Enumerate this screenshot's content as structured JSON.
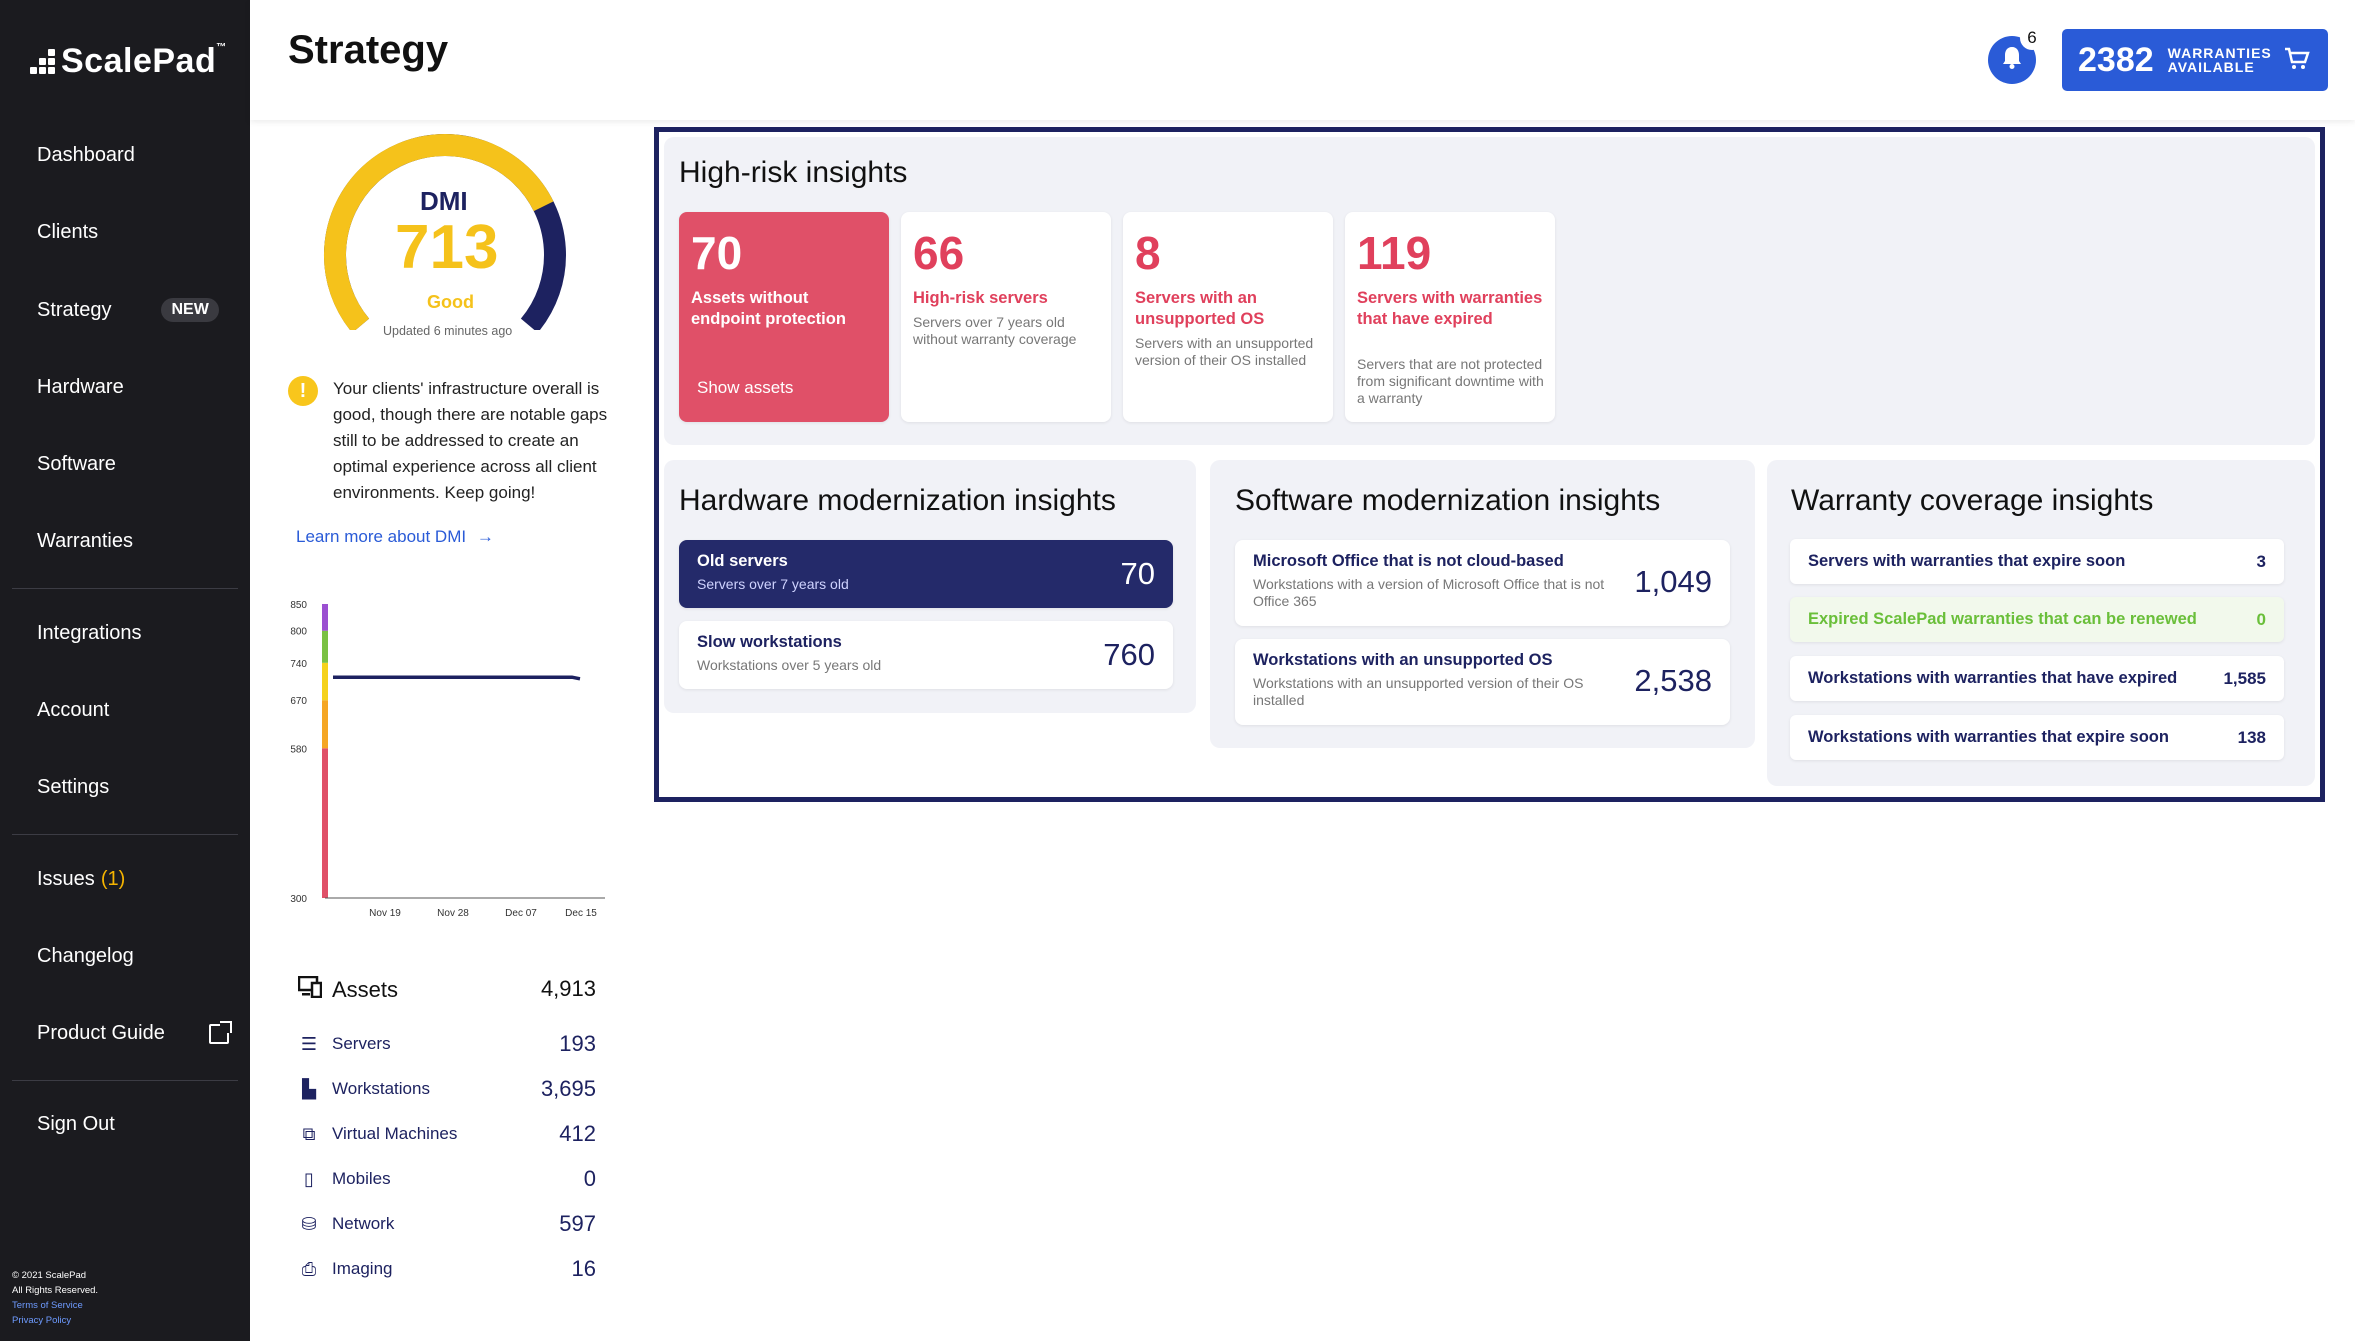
{
  "app": {
    "logo_text": "ScalePad",
    "logo_tm": "™"
  },
  "header": {
    "title": "Strategy",
    "notification_count": "6",
    "warranties_count": "2382",
    "warranties_label_1": "WARRANTIES",
    "warranties_label_2": "AVAILABLE"
  },
  "sidebar": {
    "items": [
      {
        "label": "Dashboard"
      },
      {
        "label": "Clients"
      },
      {
        "label": "Strategy",
        "badge": "NEW"
      },
      {
        "label": "Hardware"
      },
      {
        "label": "Software"
      },
      {
        "label": "Warranties"
      },
      {
        "label": "Integrations"
      },
      {
        "label": "Account"
      },
      {
        "label": "Settings"
      },
      {
        "label": "Issues",
        "count": "(1)"
      },
      {
        "label": "Changelog"
      },
      {
        "label": "Product Guide"
      },
      {
        "label": "Sign Out"
      }
    ],
    "footer": {
      "copyright": "© 2021 ScalePad",
      "rights": "All Rights Reserved.",
      "terms": "Terms of Service",
      "privacy": "Privacy Policy"
    }
  },
  "dmi": {
    "label": "DMI",
    "value": "713",
    "status": "Good",
    "updated": "Updated 6 minutes ago",
    "gauge_fraction": 0.745,
    "description": "Your clients' infrastructure overall is good, though there are notable gaps still to be addressed to create an optimal experience across all client environments. Keep going!",
    "learn_more": "Learn more about DMI"
  },
  "chart_data": {
    "type": "line",
    "y_ticks": [
      "850",
      "800",
      "740",
      "670",
      "580",
      "300"
    ],
    "x_ticks": [
      "Nov 19",
      "Nov 28",
      "Dec 07",
      "Dec 15"
    ],
    "ylim": [
      300,
      850
    ],
    "series": [
      {
        "values": [
          713,
          713,
          713,
          713,
          713,
          713,
          710
        ]
      }
    ],
    "bands": [
      {
        "from": 300,
        "to": 580,
        "color": "#e05068"
      },
      {
        "from": 580,
        "to": 670,
        "color": "#f5a623"
      },
      {
        "from": 670,
        "to": 740,
        "color": "#f5d21b"
      },
      {
        "from": 740,
        "to": 800,
        "color": "#7ac143"
      },
      {
        "from": 800,
        "to": 850,
        "color": "#9b4fd1"
      }
    ]
  },
  "assets": {
    "header_label": "Assets",
    "header_total": "4,913",
    "rows": [
      {
        "label": "Servers",
        "value": "193"
      },
      {
        "label": "Workstations",
        "value": "3,695"
      },
      {
        "label": "Virtual Machines",
        "value": "412"
      },
      {
        "label": "Mobiles",
        "value": "0"
      },
      {
        "label": "Network",
        "value": "597"
      },
      {
        "label": "Imaging",
        "value": "16"
      }
    ]
  },
  "high_risk": {
    "title": "High-risk insights",
    "cards": [
      {
        "num": "70",
        "title": "Assets without endpoint protection",
        "action": "Show assets"
      },
      {
        "num": "66",
        "title": "High-risk servers",
        "sub": "Servers over 7 years old without warranty coverage"
      },
      {
        "num": "8",
        "title": "Servers with an unsupported OS",
        "sub": "Servers with an unsupported version of their OS installed"
      },
      {
        "num": "119",
        "title": "Servers with warranties that have expired",
        "sub": "Servers that are not protected from significant downtime with a warranty"
      }
    ]
  },
  "hardware": {
    "title": "Hardware modernization insights",
    "rows": [
      {
        "title": "Old servers",
        "sub": "Servers over 7 years old",
        "value": "70"
      },
      {
        "title": "Slow workstations",
        "sub": "Workstations over 5 years old",
        "value": "760"
      }
    ]
  },
  "software": {
    "title": "Software modernization insights",
    "rows": [
      {
        "title": "Microsoft Office that is not cloud-based",
        "sub": "Workstations with a version of Microsoft Office that is not Office 365",
        "value": "1,049"
      },
      {
        "title": "Workstations with an unsupported OS",
        "sub": "Workstations with an unsupported version of their OS installed",
        "value": "2,538"
      }
    ]
  },
  "warranty": {
    "title": "Warranty coverage insights",
    "rows": [
      {
        "label": "Servers with warranties that expire soon",
        "value": "3"
      },
      {
        "label": "Expired ScalePad warranties that can be renewed",
        "value": "0"
      },
      {
        "label": "Workstations with warranties that have expired",
        "value": "1,585"
      },
      {
        "label": "Workstations with warranties that expire soon",
        "value": "138"
      }
    ]
  },
  "colors": {
    "navy": "#1d2260",
    "accent_blue": "#2a5bd7",
    "risk_red": "#e0405c",
    "gauge_yellow": "#f5c21b",
    "good_green": "#6abf3a"
  }
}
